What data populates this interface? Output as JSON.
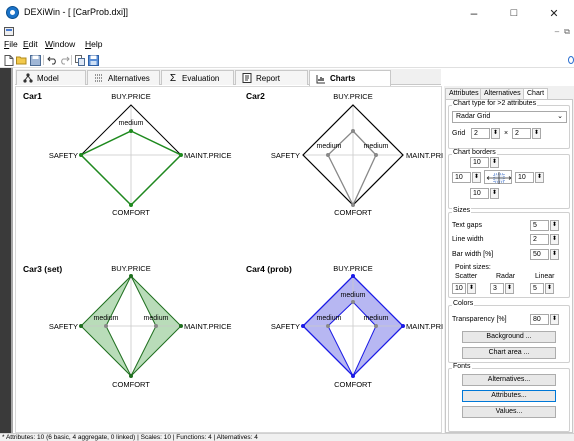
{
  "window": {
    "title": "DEXiWin - [ [CarProb.dxi]]",
    "minimize_glyph": "–",
    "maximize_glyph": "□",
    "close_glyph": "✕",
    "mdi_minimize_glyph": "–",
    "mdi_restore_glyph": "⧉"
  },
  "menu": [
    {
      "accel": "F",
      "rest": "ile"
    },
    {
      "accel": "E",
      "rest": "dit"
    },
    {
      "accel": "W",
      "rest": "indow"
    },
    {
      "accel": "H",
      "rest": "elp"
    }
  ],
  "toolbar": {
    "icons": [
      "new-file-icon",
      "open-folder-icon",
      "save-icon",
      "undo-icon",
      "redo-icon",
      "copy-icon",
      "save-all-icon"
    ]
  },
  "tabs": [
    {
      "label": "Model",
      "icon": "model-tree-icon"
    },
    {
      "label": "Alternatives",
      "icon": "alternatives-list-icon"
    },
    {
      "label": "Evaluation",
      "icon": "sigma-icon"
    },
    {
      "label": "Report",
      "icon": "report-icon"
    },
    {
      "label": "Charts",
      "icon": "charts-icon",
      "active": true
    }
  ],
  "charts": [
    {
      "title": "Car1",
      "axes": {
        "top": "BUY.PRICE",
        "right": "MAINT.PRICE",
        "bottom": "COMFORT",
        "left": "SAFETY"
      },
      "value_labels": [
        "medium"
      ]
    },
    {
      "title": "Car2",
      "axes": {
        "top": "BUY.PRICE",
        "right": "MAINT.PRICE",
        "bottom": "COMFORT",
        "left": "SAFETY"
      },
      "value_labels": [
        "medium",
        "medium"
      ]
    },
    {
      "title": "Car3 (set)",
      "axes": {
        "top": "BUY.PRICE",
        "right": "MAINT.PRICE",
        "bottom": "COMFORT",
        "left": "SAFETY"
      },
      "value_labels": [
        "medium",
        "medium"
      ]
    },
    {
      "title": "Car4 (prob)",
      "axes": {
        "top": "BUY.PRICE",
        "right": "MAINT.PRICE",
        "bottom": "COMFORT",
        "left": "SAFETY"
      },
      "value_labels": [
        "medium",
        "medium",
        "medium"
      ]
    }
  ],
  "chart_colors": {
    "car1_stroke": "#1e8a1e",
    "car2_stroke": "#888888",
    "car3_fill": "#b9dcb9",
    "car3_stroke": "#1e6e1e",
    "car4_fill": "#b7b7f2",
    "car4_stroke": "#1a1ae6",
    "grid": "#c8c8c8",
    "outline": "#000000"
  },
  "right_panel": {
    "tabs": [
      "Attributes",
      "Alternatives",
      "Chart"
    ],
    "active_tab": "Chart",
    "chart_type_label": "Chart type for >2 attributes",
    "chart_type_value": "Radar Grid",
    "grid_label": "Grid",
    "grid_cols": "2",
    "grid_times": "×",
    "grid_rows": "2",
    "borders_label": "Chart borders",
    "border_top": "10",
    "border_left": "10",
    "border_right": "10",
    "border_bottom": "10",
    "sizes_label": "Sizes",
    "text_gaps_label": "Text gaps",
    "text_gaps_value": "5",
    "line_width_label": "Line width",
    "line_width_value": "2",
    "bar_width_label": "Bar width [%]",
    "bar_width_value": "50",
    "point_sizes_label": "Point sizes:",
    "scatter_label": "Scatter",
    "radar_label": "Radar",
    "linear_label": "Linear",
    "scatter_value": "10",
    "radar_value": "3",
    "linear_value": "5",
    "colors_label": "Colors",
    "transparency_label": "Transparency [%]",
    "transparency_value": "80",
    "background_btn": "Background ...",
    "chart_area_btn": "Chart area ...",
    "fonts_label": "Fonts",
    "alternatives_btn": "Alternatives...",
    "attributes_btn": "Attributes...",
    "values_btn": "Values..."
  },
  "status": {
    "text": "* Attributes: 10 (6 basic, 4 aggregate, 0 linked)  |  Scales: 10  |  Functions: 4  |  Alternatives: 4"
  }
}
